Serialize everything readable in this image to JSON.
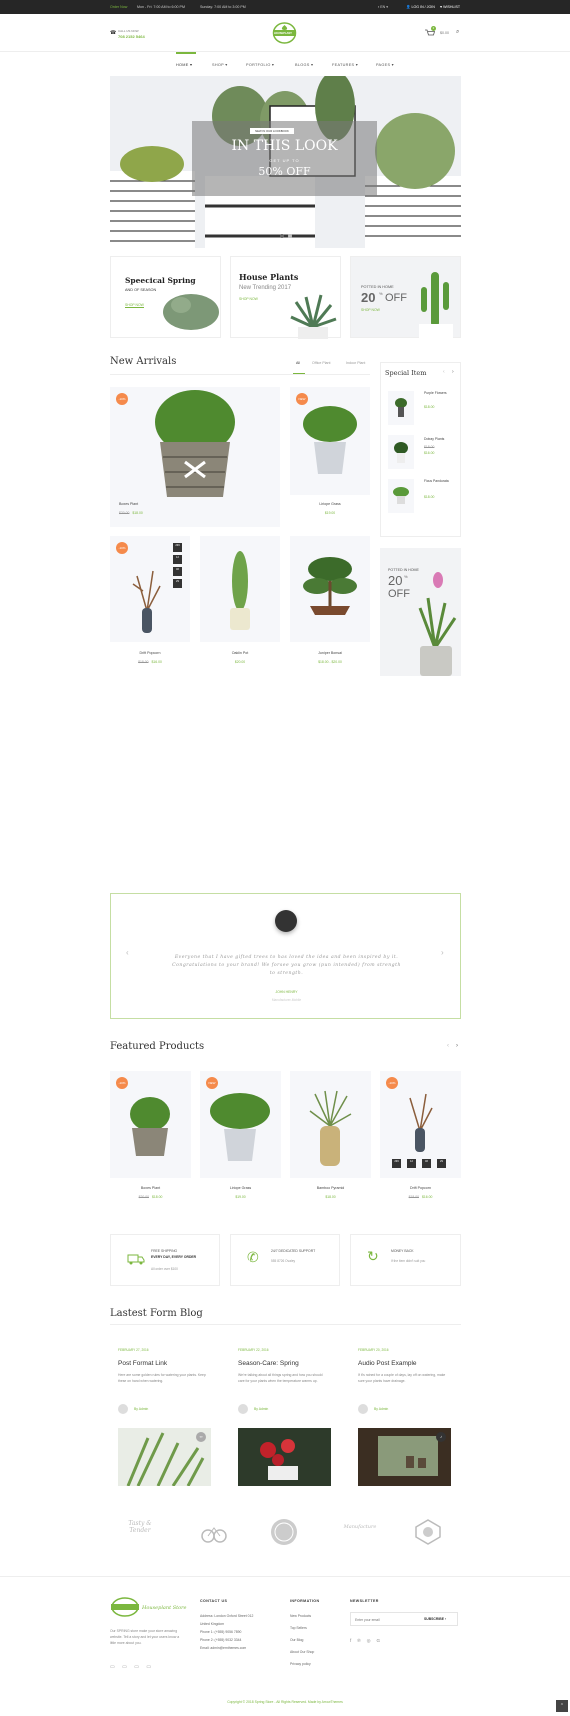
{
  "topbar": {
    "promo": "Order Now",
    "hours": "Mon - Fri: 7:00 AM to 6:00 PM",
    "sunday": "Sunday: 7:00 AM to 3:00 PM",
    "lang": "EN",
    "login": "LOG IN / JOIN",
    "wishlist": "WISHLIST"
  },
  "header": {
    "call_label": "CALL US NOW",
    "phone": "708 2152 5464",
    "logo_text": "HOUSEPLANT",
    "cart_total": "$0.00",
    "cart_count": "0"
  },
  "nav": {
    "items": [
      "HOME ▾",
      "SHOP ▾",
      "PORTFOLIO ▾",
      "BLOGS ▾",
      "FEATURES ▾",
      "PAGES ▾"
    ]
  },
  "hero": {
    "tag": "NEW IN OUR LOOKBOOK",
    "title": "IN THIS LOOK",
    "sub": "GET UP TO",
    "offer": "50% OFF"
  },
  "promos": [
    {
      "title": "Speecical Spring",
      "sub": "AND OF SEASON",
      "link": "SHOP NOW"
    },
    {
      "title": "House Plants",
      "sub": "New Trending 2017",
      "link": "SHOP NOW"
    },
    {
      "title": "POTTED IN HOME",
      "big": "20",
      "pct": "%",
      "off": "OFF",
      "link": "SHOP NOW"
    }
  ],
  "arrivals": {
    "title": "New Arrivals",
    "tabs": [
      "All",
      "Office Plant",
      "Indoor Plant"
    ]
  },
  "products": [
    {
      "name": "Boxes Plant",
      "old": "$20.00",
      "price": "$18.00",
      "badge": "-10%"
    },
    {
      "name": "Liriope Grass",
      "price": "$19.00",
      "badge": "NEW"
    },
    {
      "name": "Drift Popcorn",
      "old": "$18.00",
      "price": "$16.00",
      "badge": "-10%",
      "countdown": [
        "239",
        "12",
        "46",
        "29"
      ]
    },
    {
      "name": "Oaklin Pot",
      "price": "$20.00"
    },
    {
      "name": "Juniper Bonsai",
      "price": "$18.00 - $20.00"
    }
  ],
  "special": {
    "title": "Special Item",
    "items": [
      {
        "name": "Purple Flowers",
        "price": "$18.00"
      },
      {
        "name": "Dotray Plants",
        "old": "$18.00",
        "price": "$16.00"
      },
      {
        "name": "Ficus Pandurata",
        "price": "$18.00"
      }
    ],
    "ad": {
      "line": "POTTED IN HOME",
      "big": "20",
      "pct": "%",
      "off": "OFF"
    }
  },
  "testimonial": {
    "quote": "Everyone that I have gifted trees to has loved the idea and been inspired by it. Congratulations to your brand! We forsee you grow (pun intended) from strength to strength.",
    "name": "JOHN HENRY",
    "role": "Manufacturer-Mobile"
  },
  "featured": {
    "title": "Featured Products",
    "items": [
      {
        "name": "Boxes Plant",
        "old": "$20.00",
        "price": "$18.00",
        "badge": "-10%"
      },
      {
        "name": "Liriope Grass",
        "price": "$19.00",
        "badge": "NEW"
      },
      {
        "name": "Bamboo Pyramid",
        "price": "$18.00"
      },
      {
        "name": "Drift Popcorn",
        "old": "$18.00",
        "price": "$16.00",
        "badge": "-10%",
        "countdown": [
          "239",
          "12",
          "46",
          "29"
        ]
      }
    ]
  },
  "services": [
    {
      "title": "FREE SHIPPING",
      "sub": "EVERY DAY, EVERY ORDER",
      "desc": "All order over $100"
    },
    {
      "title": "24/7 DEDICATED SUPPORT",
      "desc": "555 8726 Ovaley"
    },
    {
      "title": "MONEY BACK",
      "desc": "If the item didn't suit you"
    }
  ],
  "blog": {
    "title": "Lastest Form Blog",
    "posts": [
      {
        "date": "FEBRUARY 27, 2016",
        "title": "Post Format Link",
        "text": "Here are some golden rules for watering your plants. Keep these on hand when watering.",
        "author": "By Admin"
      },
      {
        "date": "FEBRUARY 22, 2016",
        "title": "Season-Care: Spring",
        "text": "We're talking about all things spring and how you should care for your plants when the temperature warms up.",
        "author": "By Admin"
      },
      {
        "date": "FEBRUARY 20, 2016",
        "title": "Audio Post Example",
        "text": "If it's rained for a couple of days, lay off on watering, make sure your plants have drainage.",
        "author": "By Admin"
      }
    ]
  },
  "brands": [
    "Tasty & Tender",
    "Bicycle",
    "Stamp",
    "Manufacture",
    "Garden"
  ],
  "footer": {
    "about": "Our SPRING store make your store amazing website. Tell a story and let your users know a little more about you.",
    "contact_title": "CONTACT US",
    "contact": [
      "Address: London Oxford Street 012",
      "United Kingdom",
      "Phone 1: (+555) 9056 7890",
      "Phone 2: (+555) 9032 3344",
      "Email: admin@emthemes.com"
    ],
    "info_title": "INFORMATION",
    "info": [
      "New Products",
      "Top Sellers",
      "Our Blog",
      "About Our Shop",
      "Privacy policy"
    ],
    "news_title": "NEWSLETTER",
    "news_placeholder": "Enter your email",
    "subscribe": "SUBSCRIBE",
    "copyright": "Copyright © 2018 Spring Store - All Rights Reserved. Made by ArrowThemes"
  },
  "colors": {
    "accent": "#7bb73e",
    "dark": "#262626",
    "badge": "#f58a4b"
  }
}
